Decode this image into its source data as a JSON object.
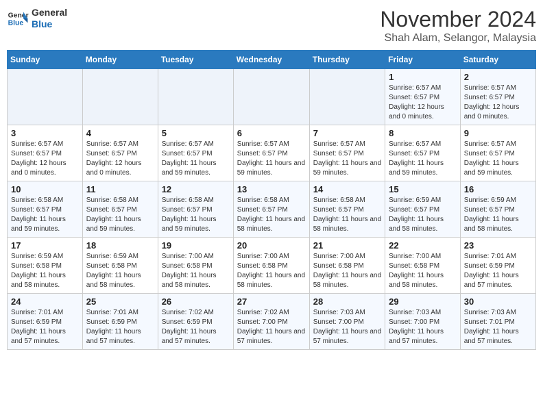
{
  "header": {
    "logo_line1": "General",
    "logo_line2": "Blue",
    "month": "November 2024",
    "location": "Shah Alam, Selangor, Malaysia"
  },
  "days_of_week": [
    "Sunday",
    "Monday",
    "Tuesday",
    "Wednesday",
    "Thursday",
    "Friday",
    "Saturday"
  ],
  "weeks": [
    [
      {
        "day": "",
        "info": ""
      },
      {
        "day": "",
        "info": ""
      },
      {
        "day": "",
        "info": ""
      },
      {
        "day": "",
        "info": ""
      },
      {
        "day": "",
        "info": ""
      },
      {
        "day": "1",
        "info": "Sunrise: 6:57 AM\nSunset: 6:57 PM\nDaylight: 12 hours and 0 minutes."
      },
      {
        "day": "2",
        "info": "Sunrise: 6:57 AM\nSunset: 6:57 PM\nDaylight: 12 hours and 0 minutes."
      }
    ],
    [
      {
        "day": "3",
        "info": "Sunrise: 6:57 AM\nSunset: 6:57 PM\nDaylight: 12 hours and 0 minutes."
      },
      {
        "day": "4",
        "info": "Sunrise: 6:57 AM\nSunset: 6:57 PM\nDaylight: 12 hours and 0 minutes."
      },
      {
        "day": "5",
        "info": "Sunrise: 6:57 AM\nSunset: 6:57 PM\nDaylight: 11 hours and 59 minutes."
      },
      {
        "day": "6",
        "info": "Sunrise: 6:57 AM\nSunset: 6:57 PM\nDaylight: 11 hours and 59 minutes."
      },
      {
        "day": "7",
        "info": "Sunrise: 6:57 AM\nSunset: 6:57 PM\nDaylight: 11 hours and 59 minutes."
      },
      {
        "day": "8",
        "info": "Sunrise: 6:57 AM\nSunset: 6:57 PM\nDaylight: 11 hours and 59 minutes."
      },
      {
        "day": "9",
        "info": "Sunrise: 6:57 AM\nSunset: 6:57 PM\nDaylight: 11 hours and 59 minutes."
      }
    ],
    [
      {
        "day": "10",
        "info": "Sunrise: 6:58 AM\nSunset: 6:57 PM\nDaylight: 11 hours and 59 minutes."
      },
      {
        "day": "11",
        "info": "Sunrise: 6:58 AM\nSunset: 6:57 PM\nDaylight: 11 hours and 59 minutes."
      },
      {
        "day": "12",
        "info": "Sunrise: 6:58 AM\nSunset: 6:57 PM\nDaylight: 11 hours and 59 minutes."
      },
      {
        "day": "13",
        "info": "Sunrise: 6:58 AM\nSunset: 6:57 PM\nDaylight: 11 hours and 58 minutes."
      },
      {
        "day": "14",
        "info": "Sunrise: 6:58 AM\nSunset: 6:57 PM\nDaylight: 11 hours and 58 minutes."
      },
      {
        "day": "15",
        "info": "Sunrise: 6:59 AM\nSunset: 6:57 PM\nDaylight: 11 hours and 58 minutes."
      },
      {
        "day": "16",
        "info": "Sunrise: 6:59 AM\nSunset: 6:57 PM\nDaylight: 11 hours and 58 minutes."
      }
    ],
    [
      {
        "day": "17",
        "info": "Sunrise: 6:59 AM\nSunset: 6:58 PM\nDaylight: 11 hours and 58 minutes."
      },
      {
        "day": "18",
        "info": "Sunrise: 6:59 AM\nSunset: 6:58 PM\nDaylight: 11 hours and 58 minutes."
      },
      {
        "day": "19",
        "info": "Sunrise: 7:00 AM\nSunset: 6:58 PM\nDaylight: 11 hours and 58 minutes."
      },
      {
        "day": "20",
        "info": "Sunrise: 7:00 AM\nSunset: 6:58 PM\nDaylight: 11 hours and 58 minutes."
      },
      {
        "day": "21",
        "info": "Sunrise: 7:00 AM\nSunset: 6:58 PM\nDaylight: 11 hours and 58 minutes."
      },
      {
        "day": "22",
        "info": "Sunrise: 7:00 AM\nSunset: 6:58 PM\nDaylight: 11 hours and 58 minutes."
      },
      {
        "day": "23",
        "info": "Sunrise: 7:01 AM\nSunset: 6:59 PM\nDaylight: 11 hours and 57 minutes."
      }
    ],
    [
      {
        "day": "24",
        "info": "Sunrise: 7:01 AM\nSunset: 6:59 PM\nDaylight: 11 hours and 57 minutes."
      },
      {
        "day": "25",
        "info": "Sunrise: 7:01 AM\nSunset: 6:59 PM\nDaylight: 11 hours and 57 minutes."
      },
      {
        "day": "26",
        "info": "Sunrise: 7:02 AM\nSunset: 6:59 PM\nDaylight: 11 hours and 57 minutes."
      },
      {
        "day": "27",
        "info": "Sunrise: 7:02 AM\nSunset: 7:00 PM\nDaylight: 11 hours and 57 minutes."
      },
      {
        "day": "28",
        "info": "Sunrise: 7:03 AM\nSunset: 7:00 PM\nDaylight: 11 hours and 57 minutes."
      },
      {
        "day": "29",
        "info": "Sunrise: 7:03 AM\nSunset: 7:00 PM\nDaylight: 11 hours and 57 minutes."
      },
      {
        "day": "30",
        "info": "Sunrise: 7:03 AM\nSunset: 7:01 PM\nDaylight: 11 hours and 57 minutes."
      }
    ]
  ]
}
